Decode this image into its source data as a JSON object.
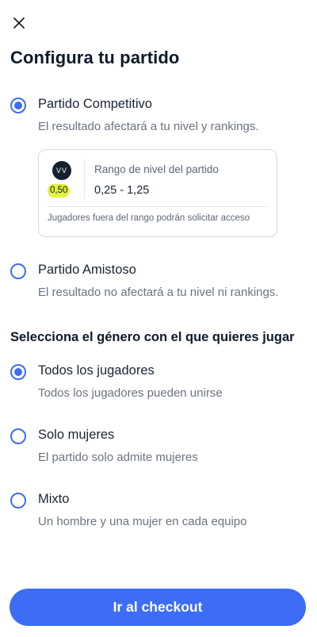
{
  "header": {
    "close_icon": "close-icon",
    "title": "Configura tu partido"
  },
  "match_type": {
    "selected": "competitive",
    "options": [
      {
        "label": "Partido Competitivo",
        "description": "El resultado afectará a tu nivel y rankings.",
        "checked": true
      },
      {
        "label": "Partido Amistoso",
        "description": "El resultado no afectará a tu nivel ni rankings.",
        "checked": false
      }
    ]
  },
  "level_card": {
    "avatar_initials": "VV",
    "player_level": "0,50",
    "range_title": "Rango de nivel del partido",
    "range_value": "0,25 - 1,25",
    "note": "Jugadores fuera del rango podrán solicitar acceso",
    "badge_color": "#e4f23b"
  },
  "gender": {
    "section_title": "Selecciona el género con el que quieres jugar",
    "options": [
      {
        "label": "Todos los jugadores",
        "description": "Todos los jugadores pueden unirse",
        "checked": true
      },
      {
        "label": "Solo mujeres",
        "description": "El partido solo admite mujeres",
        "checked": false
      },
      {
        "label": "Mixto",
        "description": "Un hombre y una mujer en cada equipo",
        "checked": false
      }
    ]
  },
  "footer": {
    "checkout_label": "Ir al checkout"
  },
  "colors": {
    "accent": "#3d6df5",
    "text": "#0e1a2b",
    "muted": "#6b7380"
  }
}
